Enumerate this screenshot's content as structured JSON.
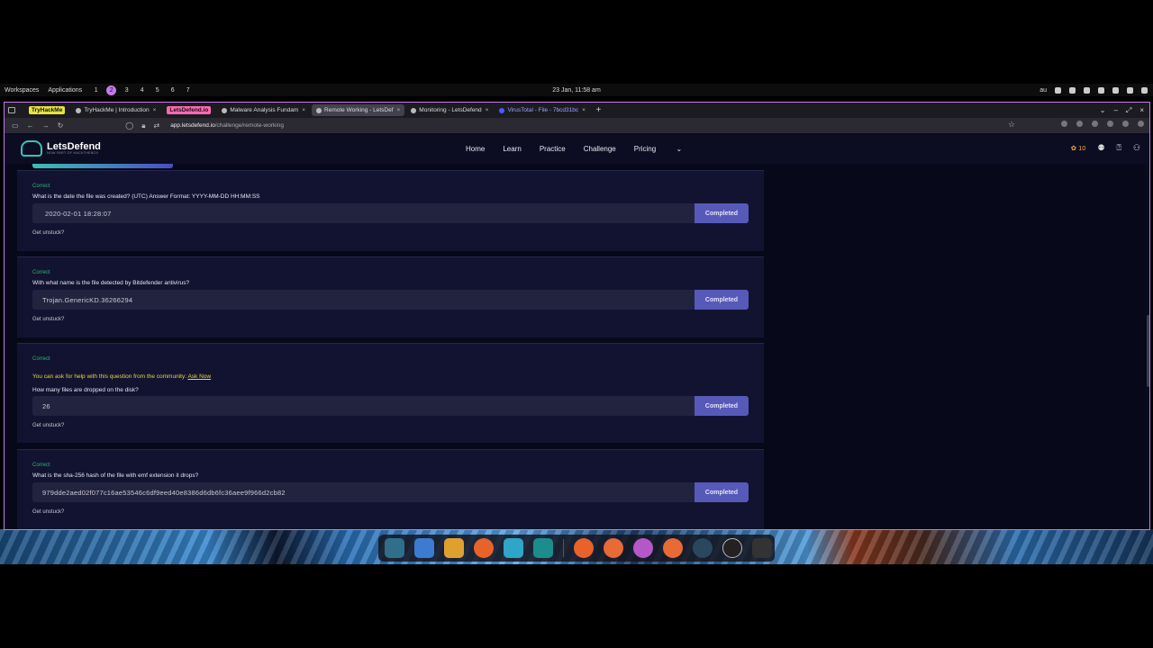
{
  "desktop": {
    "workspaces_label": "Workspaces",
    "applications_label": "Applications",
    "workspace_numbers": [
      "1",
      "2",
      "3",
      "4",
      "5",
      "6",
      "7"
    ],
    "active_workspace": "2",
    "clock": "23 Jan, 11:58 am",
    "keyboard_layout": "au"
  },
  "browser": {
    "tabs": [
      {
        "label": "TryHackMe",
        "kind": "pill-yellow"
      },
      {
        "label": "TryHackMe | Introduction",
        "kind": "normal"
      },
      {
        "label": "LetsDefend.io",
        "kind": "pill-pink"
      },
      {
        "label": "Malware Analysis Fundam",
        "kind": "normal"
      },
      {
        "label": "Remote Working - LetsDef",
        "kind": "active"
      },
      {
        "label": "Monitoring - LetsDefend",
        "kind": "normal"
      },
      {
        "label": "VirusTotal - File - 7bcd31bc",
        "kind": "normal"
      }
    ],
    "url_domain": "app.letsdefend.io",
    "url_path": "/challenge/remote-working"
  },
  "site": {
    "logo_text": "LetsDefend",
    "logo_sub": "NOW PART OF HACKTHEBOX",
    "menu": [
      "Home",
      "Learn",
      "Practice",
      "Challenge",
      "Pricing"
    ],
    "credits": "10"
  },
  "questions": [
    {
      "status": "Correct",
      "question": "What is the date the file was created? (UTC) Answer Format: YYYY-MM-DD HH:MM:SS",
      "answer": "2020-02-01 18:28:07",
      "button": "Completed",
      "unstuck": "Get unstuck?"
    },
    {
      "status": "Correct",
      "question": "With what name is the file detected by Bitdefender antivirus?",
      "answer": "Trojan.GenericKD.36266294",
      "button": "Completed",
      "unstuck": "Get unstuck?"
    },
    {
      "status": "Correct",
      "help_prefix": "You can ask for help with this question from the community: ",
      "help_link": "Ask Now",
      "question": "How many files are dropped on the disk?",
      "answer": "26",
      "button": "Completed",
      "unstuck": "Get unstuck?"
    },
    {
      "status": "Correct",
      "question": "What is the sha-256 hash of the file with emf extension it drops?",
      "answer": "979dde2aed02f077c16ae53546c6df9eed40e8386d6db6fc36aee9f966d2cb82",
      "button": "Completed",
      "unstuck": "Get unstuck?"
    }
  ],
  "colors": {
    "correct": "#2bb673",
    "completed_button": "#5759b9",
    "help_text": "#e8d63f",
    "window_border": "#c57ae8"
  }
}
